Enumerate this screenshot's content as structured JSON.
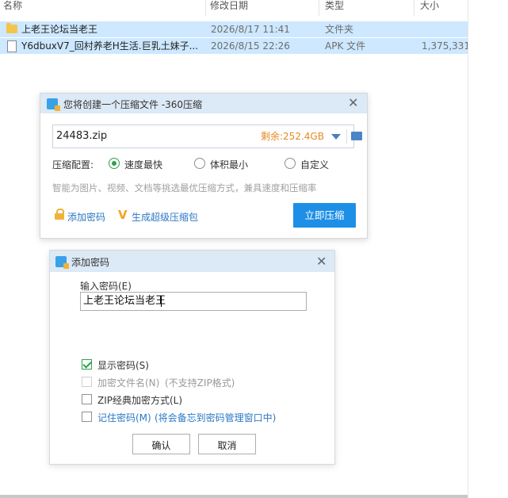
{
  "columns": [
    "名称",
    "修改日期",
    "类型",
    "大小"
  ],
  "files": [
    {
      "name": "上老王论坛当老王",
      "date": "2026/8/17 11:41",
      "type": "文件夹",
      "size": "",
      "icon": "folder-icon"
    },
    {
      "name": "Y6dbuxV7_回村养老H生活.巨乳土妹子...",
      "date": "2026/8/15 22:26",
      "type": "APK 文件",
      "size": "1,375,331.",
      "icon": "file-icon"
    }
  ],
  "compress_dialog": {
    "title": "您将创建一个压缩文件 -360压缩",
    "filename": "24483.zip",
    "free_space": "剩余:252.4GB",
    "config_label": "压缩配置:",
    "options": [
      "速度最快",
      "体积最小",
      "自定义"
    ],
    "selected_option": "速度最快",
    "hint": "智能为图片、视频、文档等挑选最优压缩方式，兼具速度和压缩率",
    "add_password": "添加密码",
    "super_pack": "生成超级压缩包",
    "start_button": "立即压缩",
    "colors": {
      "accent": "#1e8fe6",
      "orange": "#e58a1f",
      "green": "#2ea04a"
    }
  },
  "password_dialog": {
    "title": "添加密码",
    "input_label": "输入密码(E)",
    "password_value": "上老王论坛当老王",
    "show_password": "显示密码(S)",
    "encrypt_names": "加密文件名(N)",
    "encrypt_names_note": "(不支持ZIP格式)",
    "zip_classic": "ZIP经典加密方式(L)",
    "remember": "记住密码(M)",
    "remember_note": "(将会备忘到密码管理窗口中)",
    "ok": "确认",
    "cancel": "取消"
  }
}
